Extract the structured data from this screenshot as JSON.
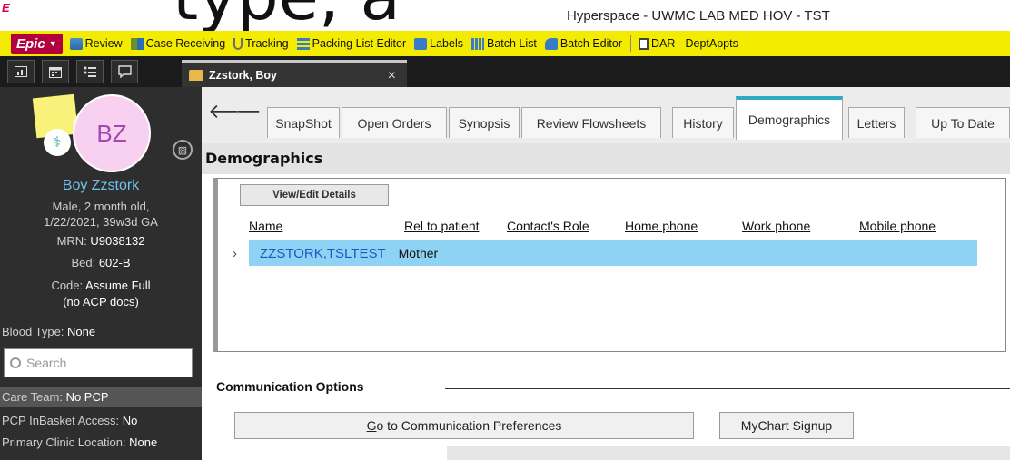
{
  "window": {
    "overlay_heading": "type, a",
    "title": "Hyperspace - UWMC LAB MED HOV - TST"
  },
  "toolbar": {
    "epic_label": "Epic",
    "items": [
      {
        "label": "Review",
        "icon": "review-icon"
      },
      {
        "label": "Case Receiving",
        "icon": "case-receiving-icon"
      },
      {
        "label": "Tracking",
        "icon": "tracking-icon"
      },
      {
        "label": "Packing List Editor",
        "icon": "packing-list-icon"
      },
      {
        "label": "Labels",
        "icon": "labels-icon"
      },
      {
        "label": "Batch List",
        "icon": "batch-list-icon"
      },
      {
        "label": "Batch Editor",
        "icon": "batch-editor-icon"
      },
      {
        "label": "DAR - DeptAppts",
        "icon": "clipboard-icon"
      }
    ]
  },
  "tabstrip": {
    "patient_tab_label": "Zzstork, Boy",
    "close_glyph": "×"
  },
  "sidebar": {
    "avatar_initials": "BZ",
    "patient_name": "Boy Zzstork",
    "line1": "Male, 2 month old,",
    "line2": "1/22/2021, 39w3d GA",
    "mrn_label": "MRN: ",
    "mrn_value": "U9038132",
    "bed_label": "Bed: ",
    "bed_value": "602-B",
    "code_label": "Code: ",
    "code_value": "Assume Full",
    "code_note": "(no ACP docs)",
    "blood_label": "Blood Type: ",
    "blood_value": "None",
    "search_placeholder": "Search",
    "care_team_label": "Care Team: ",
    "care_team_value": "No PCP",
    "pcp_inbasket_label": "PCP InBasket Access: ",
    "pcp_inbasket_value": "No",
    "primary_clinic_label": "Primary Clinic Location: ",
    "primary_clinic_value": "None"
  },
  "activity_tabs": [
    {
      "label": "SnapShot"
    },
    {
      "label": "Open Orders"
    },
    {
      "label": "Synopsis"
    },
    {
      "label": "Review Flowsheets"
    },
    {
      "label": "History"
    },
    {
      "label": "Demographics"
    },
    {
      "label": "Letters"
    },
    {
      "label": "Up To Date"
    }
  ],
  "demographics": {
    "section_title": "Demographics",
    "view_edit_label": "View/Edit Details",
    "columns": [
      "Name",
      "Rel to patient",
      "Contact's Role",
      "Home phone",
      "Work phone",
      "Mobile phone"
    ],
    "contacts": [
      {
        "name": "ZZSTORK,TSLTEST",
        "relation": "Mother"
      }
    ],
    "comm_options_label": "Communication Options",
    "comm_pref_prefix": "G",
    "comm_pref_rest": "o to Communication Preferences",
    "mychart_label": "MyChart Signup"
  }
}
